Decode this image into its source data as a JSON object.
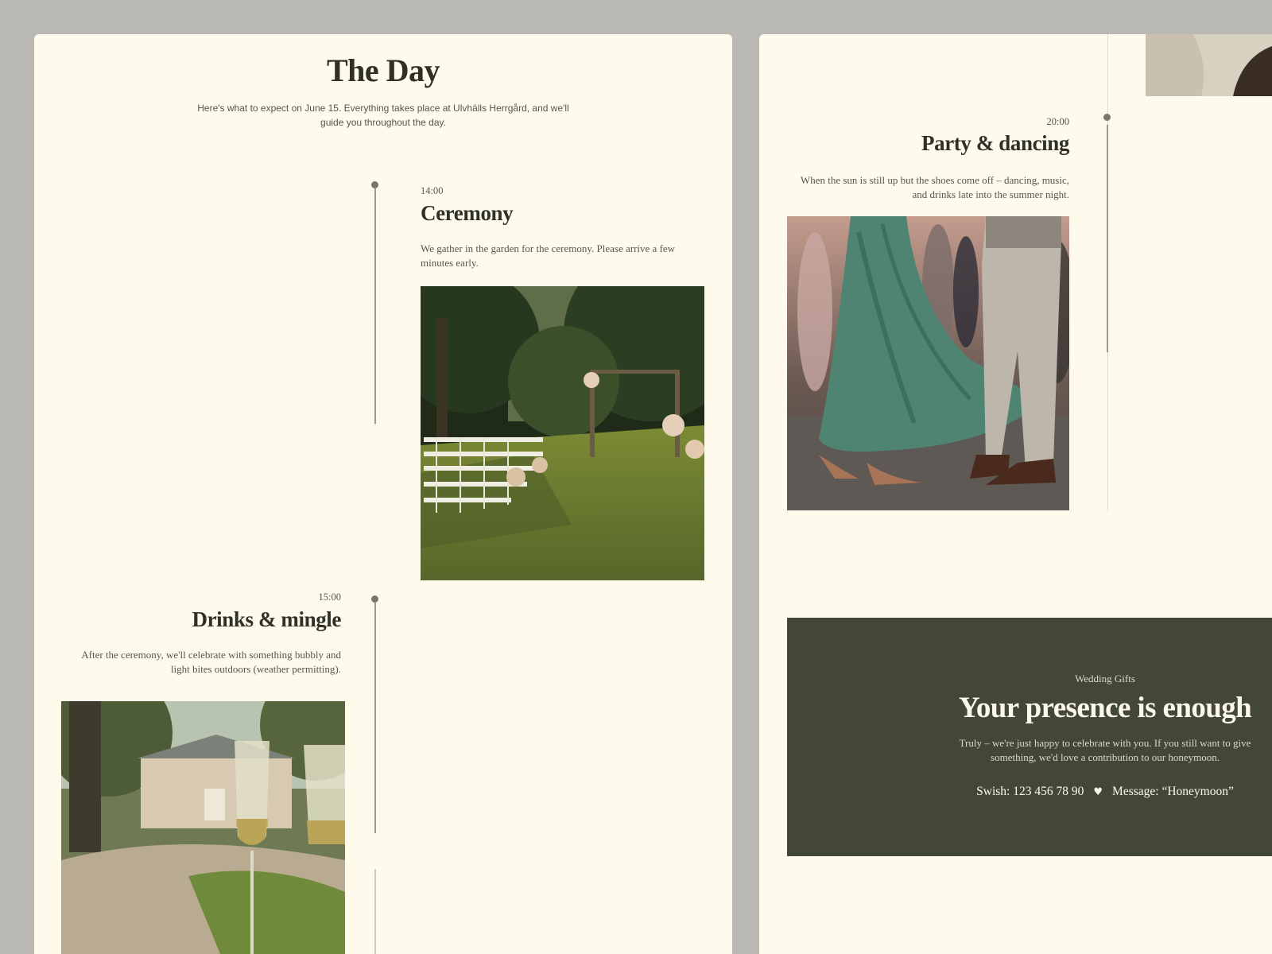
{
  "day": {
    "title": "The Day",
    "intro": "Here's what to expect on June 15. Everything takes place at Ulvhälls Herrgård, and we'll guide you throughout the day."
  },
  "events": [
    {
      "time": "14:00",
      "title": "Ceremony",
      "description": "We gather in the garden for the ceremony. Please arrive a few minutes early.",
      "photo": "garden-ceremony-photo"
    },
    {
      "time": "15:00",
      "title": "Drinks & mingle",
      "description": "After the ceremony, we'll celebrate with something bubbly and light bites outdoors (weather permitting).",
      "photo": "champagne-photo"
    },
    {
      "time": "20:00",
      "title": "Party & dancing",
      "description": "When the sun is still up but the shoes come off – dancing, music, and drinks late into the summer night.",
      "photo": "dancing-photo"
    }
  ],
  "gifts": {
    "eyebrow": "Wedding Gifts",
    "title": "Your presence is enough",
    "body": "Truly – we're just happy to celebrate with you. If you still want to give something, we'd love a contribution to our honeymoon.",
    "swish": "Swish: 123 456 78 90",
    "message": "Message: “Honeymoon”",
    "separator_icon": "heart-icon"
  },
  "colors": {
    "background": "#bab9b4",
    "card": "#fefbed",
    "text_dark": "#2f3127",
    "gift_panel": "#434737"
  }
}
